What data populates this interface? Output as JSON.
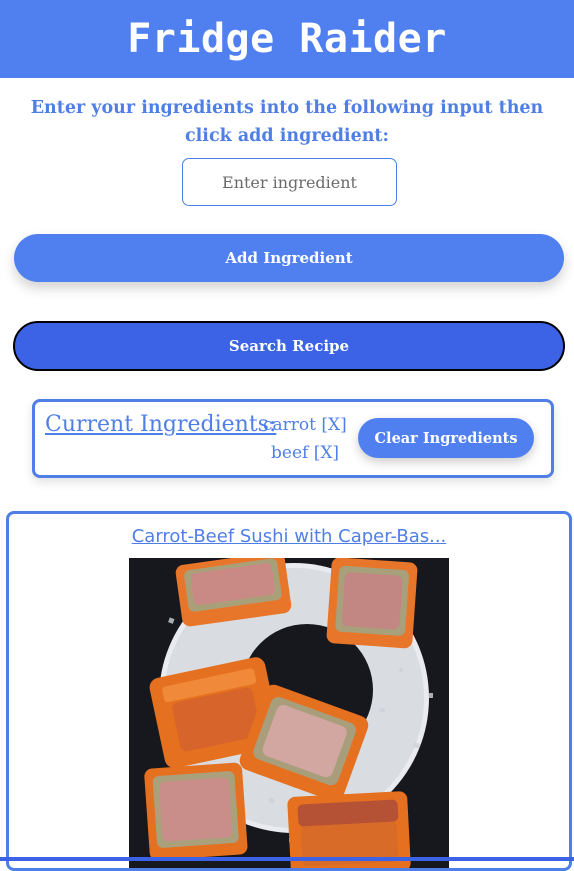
{
  "app": {
    "title": "Fridge Raider"
  },
  "instructions": "Enter your ingredients into the following input then click add ingredient:",
  "ingredient_input": {
    "placeholder": "Enter ingredient",
    "value": ""
  },
  "buttons": {
    "add_label": "Add Ingredient",
    "search_label": "Search Recipe",
    "clear_label": "Clear Ingredients"
  },
  "current": {
    "heading": "Current Ingredients:",
    "items": [
      {
        "label": "carrot [X]"
      },
      {
        "label": "beef [X]"
      }
    ]
  },
  "recipe": {
    "title": "Carrot-Beef Sushi with Caper-Bas...",
    "image_alt": "sushi-food-photo"
  },
  "colors": {
    "primary": "#5080f0",
    "search_button": "#3c63e6",
    "text_accent": "#4f7fe6",
    "image_background": "#1a1b20",
    "carrot_orange": "#e8762a"
  }
}
